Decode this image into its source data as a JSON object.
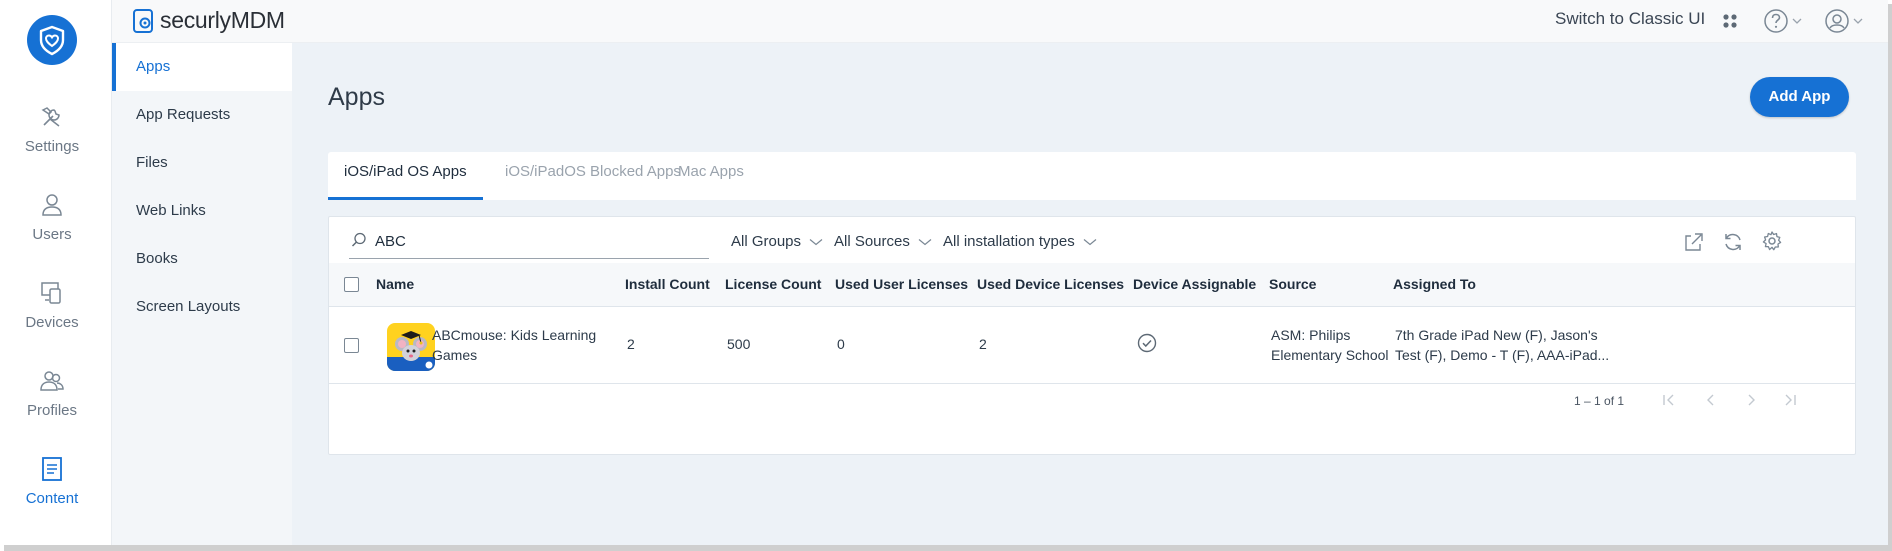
{
  "brand": {
    "part1": "securly",
    "part2": "MDM"
  },
  "rail": [
    {
      "label": "Settings",
      "icon": "tools-icon"
    },
    {
      "label": "Users",
      "icon": "user-icon"
    },
    {
      "label": "Devices",
      "icon": "devices-icon"
    },
    {
      "label": "Profiles",
      "icon": "profiles-icon"
    },
    {
      "label": "Content",
      "icon": "document-icon",
      "active": true
    }
  ],
  "subnav": [
    "Apps",
    "App Requests",
    "Files",
    "Web Links",
    "Books",
    "Screen Layouts"
  ],
  "topbar": {
    "classic_label": "Switch to Classic UI"
  },
  "page": {
    "title": "Apps",
    "add_button": "Add App"
  },
  "tabs": [
    "iOS/iPad OS Apps",
    "iOS/iPadOS Blocked Apps",
    "Mac Apps"
  ],
  "filters": {
    "search_value": "ABC",
    "groups": "All Groups",
    "sources": "All Sources",
    "install_types": "All installation types"
  },
  "table": {
    "columns": [
      "Name",
      "Install Count",
      "License Count",
      "Used User Licenses",
      "Used Device Licenses",
      "Device Assignable",
      "Source",
      "Assigned To"
    ],
    "rows": [
      {
        "name_line1": "ABCmouse: Kids Learning",
        "name_line2": "Games",
        "install_count": "2",
        "license_count": "500",
        "used_user_licenses": "0",
        "used_device_licenses": "2",
        "device_assignable": true,
        "source_line1": "ASM: Philips",
        "source_line2": "Elementary School",
        "assigned_line1": "7th Grade iPad New (F), Jason's",
        "assigned_line2": "Test (F), Demo - T (F), AAA-iPad..."
      }
    ]
  },
  "pagination": {
    "range": "1 – 1 of 1"
  },
  "colors": {
    "accent": "#1671d4",
    "background": "#edf2f7"
  }
}
